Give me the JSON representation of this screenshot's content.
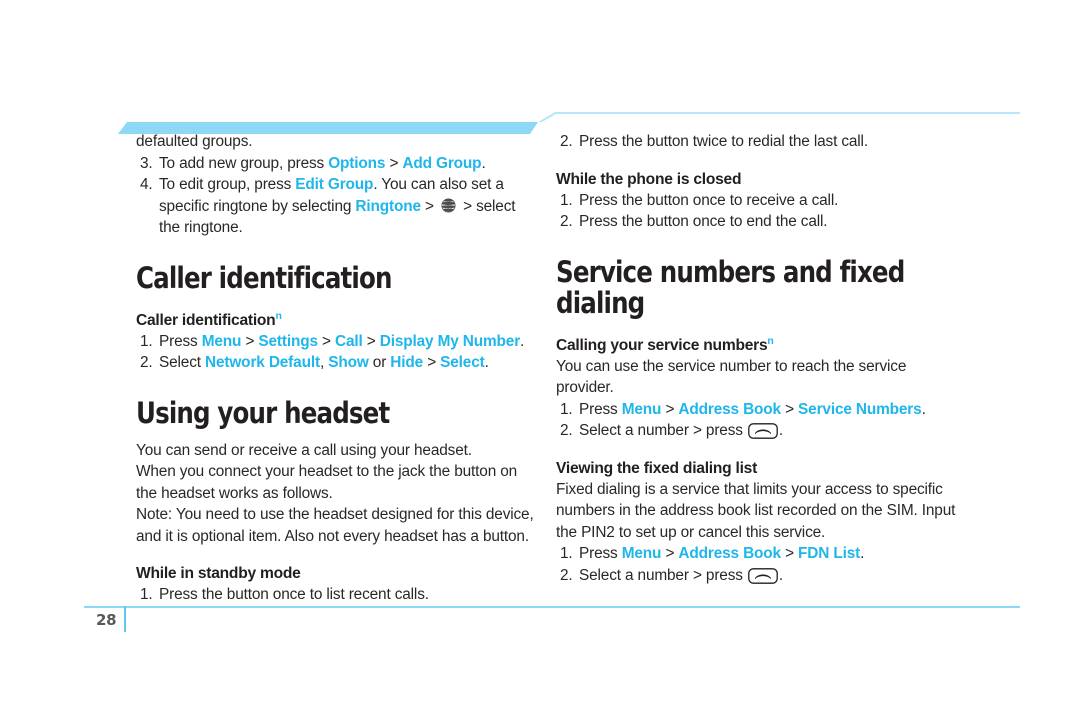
{
  "document": {
    "page_number": "28",
    "accent_color": "#1fb6ea",
    "rule_color": "#8fd8f5"
  },
  "left_column": {
    "continued_text": "defaulted groups.",
    "group_steps": [
      {
        "num": "3.",
        "prefix": "To add new group, press ",
        "link1": "Options",
        "sep1": " > ",
        "link2": "Add Group",
        "suffix": "."
      },
      {
        "num": "4.",
        "prefix": "To edit group, press ",
        "link1": "Edit Group",
        "mid": ". You can also set a specific ringtone by selecting ",
        "link2": "Ringtone",
        "sep1": " > ",
        "icon": "att-globe-icon",
        "sep2": " > ",
        "suffix": "select the ringtone."
      }
    ],
    "heading_caller_id": "Caller identification",
    "sub_caller_id": "Caller identification",
    "sub_caller_id_sup": "n",
    "caller_id_steps": [
      {
        "num": "1.",
        "prefix": "Press ",
        "links": [
          "Menu",
          "Settings",
          "Call",
          "Display My Number"
        ],
        "suffix": "."
      },
      {
        "num": "2.",
        "prefix": "Select ",
        "link1": "Network Default",
        "comma": ", ",
        "link2": "Show",
        "or": " or ",
        "link3": "Hide",
        "sep": " > ",
        "link4": "Select",
        "suffix": "."
      }
    ],
    "heading_headset": "Using your headset",
    "headset_paragraphs": [
      "You can send or receive a call using your headset.",
      "When you connect your headset to the jack the button on the headset works as follows.",
      "Note: You need to use the headset designed for this device, and it is optional item. Also not every headset has a button."
    ],
    "sub_standby": "While in standby mode",
    "standby_steps": [
      {
        "num": "1.",
        "text": "Press the button once to list recent calls."
      }
    ]
  },
  "right_column": {
    "standby_continued": [
      {
        "num": "2.",
        "text": "Press the button twice to redial the last call."
      }
    ],
    "sub_closed": "While the phone is closed",
    "closed_steps": [
      {
        "num": "1.",
        "text": "Press the button once to receive a call."
      },
      {
        "num": "2.",
        "text": "Press the button once to end the call."
      }
    ],
    "heading_service": "Service numbers and fixed dialing",
    "sub_calling": "Calling your service numbers",
    "sub_calling_sup": "n",
    "calling_intro": "You can use the service number to reach the service provider.",
    "calling_steps": [
      {
        "num": "1.",
        "prefix": "Press ",
        "links": [
          "Menu",
          "Address Book",
          "Service Numbers"
        ],
        "suffix": "."
      },
      {
        "num": "2.",
        "prefix": "Select a number > press ",
        "icon": "send-key-icon",
        "suffix": "."
      }
    ],
    "sub_fdn": "Viewing the fixed dialing list",
    "fdn_intro": "Fixed dialing is a service that limits your access to specific numbers in the address book list recorded on the SIM. Input the PIN2 to set up or cancel this service.",
    "fdn_steps": [
      {
        "num": "1.",
        "prefix": "Press ",
        "links": [
          "Menu",
          "Address Book",
          "FDN List"
        ],
        "suffix": "."
      },
      {
        "num": "2.",
        "prefix": "Select a number > press ",
        "icon": "send-key-icon",
        "suffix": "."
      }
    ]
  }
}
